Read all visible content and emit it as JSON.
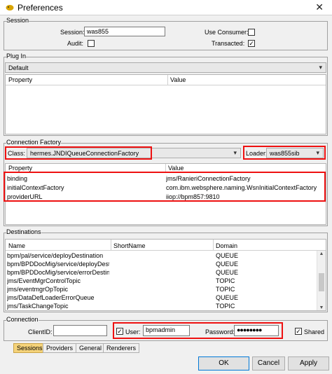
{
  "window": {
    "title": "Preferences",
    "close_glyph": "✕"
  },
  "session": {
    "group_label": "Session",
    "session_label": "Session:",
    "session_value": "was855",
    "use_consumer_label": "Use Consumer:",
    "use_consumer_checked": false,
    "audit_label": "Audit:",
    "audit_checked": false,
    "transacted_label": "Transacted:",
    "transacted_checked": true
  },
  "plugin": {
    "group_label": "Plug In",
    "selected": "Default",
    "columns": [
      "Property",
      "Value"
    ]
  },
  "connection_factory": {
    "group_label": "Connection Factory",
    "class_label": "Class:",
    "class_value": "hermes.JNDIQueueConnectionFactory",
    "loader_label": "Loader:",
    "loader_value": "was855sib",
    "columns": [
      "Property",
      "Value"
    ],
    "rows": [
      {
        "property": "binding",
        "value": "jms/RanieriConnectionFactory"
      },
      {
        "property": "initialContextFactory",
        "value": "com.ibm.websphere.naming.WsnInitialContextFactory"
      },
      {
        "property": "providerURL",
        "value": "iiop://bpm857:9810"
      }
    ]
  },
  "destinations": {
    "group_label": "Destinations",
    "columns": [
      "Name",
      "ShortName",
      "Domain"
    ],
    "rows": [
      {
        "name": "bpm/pal/service/deployDestination",
        "short": "",
        "domain": "QUEUE"
      },
      {
        "name": "bpm/BPDDocMig/service/deployDesti...",
        "short": "",
        "domain": "QUEUE"
      },
      {
        "name": "bpm/BPDDocMig/service/errorDestina...",
        "short": "",
        "domain": "QUEUE"
      },
      {
        "name": "jms/EventMgrControlTopic",
        "short": "",
        "domain": "TOPIC"
      },
      {
        "name": "jms/eventmgrOpTopic",
        "short": "",
        "domain": "TOPIC"
      },
      {
        "name": "jms/DataDefLoaderErrorQueue",
        "short": "",
        "domain": "QUEUE"
      },
      {
        "name": "jms/TaskChangeTopic",
        "short": "",
        "domain": "TOPIC"
      }
    ]
  },
  "connection": {
    "group_label": "Connection",
    "client_id_label": "ClientID:",
    "client_id_value": "",
    "user_label": "User:",
    "user_checked": true,
    "user_value": "bpmadmin",
    "password_label": "Password:",
    "password_value": "●●●●●●●●",
    "shared_label": "Shared",
    "shared_checked": true
  },
  "tabs": [
    "Sessions",
    "Providers",
    "General",
    "Renderers"
  ],
  "active_tab": "Sessions",
  "buttons": {
    "ok": "OK",
    "cancel": "Cancel",
    "apply": "Apply"
  },
  "colors": {
    "highlight": "#e11111",
    "active_tab": "#f5d37a"
  },
  "check_glyph": "✓"
}
